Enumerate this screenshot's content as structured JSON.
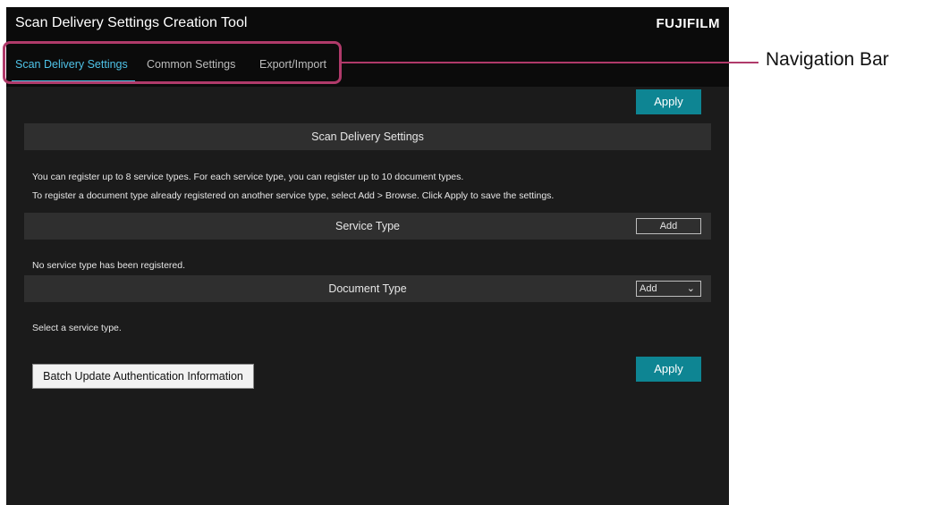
{
  "window": {
    "title": "Scan Delivery Settings Creation Tool",
    "brand": "FUJIFILM"
  },
  "nav": {
    "tabs": [
      {
        "label": "Scan Delivery Settings",
        "active": true
      },
      {
        "label": "Common Settings",
        "active": false
      },
      {
        "label": "Export/Import",
        "active": false
      }
    ]
  },
  "toolbar": {
    "apply_label": "Apply"
  },
  "sections": {
    "scan_delivery": {
      "title": "Scan Delivery Settings",
      "info_line1": "You can register up to 8 service types. For each service type, you can register up to 10 document types.",
      "info_line2": "To register a document type already registered on another service type, select Add > Browse. Click Apply to save the settings."
    },
    "service_type": {
      "title": "Service Type",
      "add_label": "Add",
      "empty_message": "No service type has been registered."
    },
    "document_type": {
      "title": "Document Type",
      "add_label": "Add",
      "empty_message": "Select a service type."
    }
  },
  "footer": {
    "batch_update_label": "Batch Update Authentication Information",
    "apply_label": "Apply"
  },
  "annotation": {
    "label": "Navigation Bar"
  },
  "colors": {
    "accent_tab": "#4fc3e8",
    "apply_button": "#0e8593",
    "callout": "#b03a6a"
  },
  "icons": {
    "dropdown": "chevron-down-icon",
    "scroll_up": "chevron-up-icon"
  }
}
